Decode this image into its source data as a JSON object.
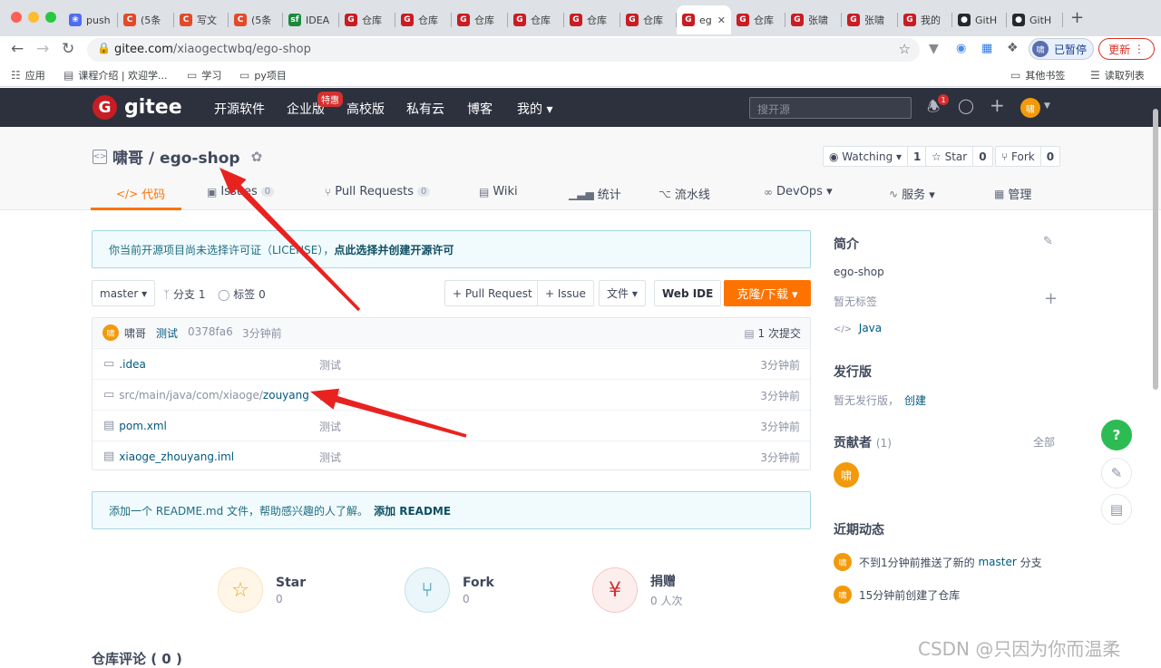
{
  "browser": {
    "tabs": [
      {
        "label": "push",
        "fav_color": "#4e6ef2",
        "fav_glyph": "❀"
      },
      {
        "label": "(5条",
        "fav_color": "#e24a2a",
        "fav_glyph": "C"
      },
      {
        "label": "写文",
        "fav_color": "#e24a2a",
        "fav_glyph": "C"
      },
      {
        "label": "(5条",
        "fav_color": "#e24a2a",
        "fav_glyph": "C"
      },
      {
        "label": "IDEA",
        "fav_color": "#1a8a3d",
        "fav_glyph": "sf"
      },
      {
        "label": "仓库",
        "fav_color": "#c71d23",
        "fav_glyph": "G"
      },
      {
        "label": "仓库",
        "fav_color": "#c71d23",
        "fav_glyph": "G"
      },
      {
        "label": "仓库",
        "fav_color": "#c71d23",
        "fav_glyph": "G"
      },
      {
        "label": "仓库",
        "fav_color": "#c71d23",
        "fav_glyph": "G"
      },
      {
        "label": "仓库",
        "fav_color": "#c71d23",
        "fav_glyph": "G"
      },
      {
        "label": "仓库",
        "fav_color": "#c71d23",
        "fav_glyph": "G"
      },
      {
        "label": "eg",
        "fav_color": "#c71d23",
        "fav_glyph": "G",
        "active": true
      },
      {
        "label": "仓库",
        "fav_color": "#c71d23",
        "fav_glyph": "G"
      },
      {
        "label": "张啸",
        "fav_color": "#c71d23",
        "fav_glyph": "G"
      },
      {
        "label": "张啸",
        "fav_color": "#c71d23",
        "fav_glyph": "G"
      },
      {
        "label": "我的",
        "fav_color": "#c71d23",
        "fav_glyph": "G"
      },
      {
        "label": "GitH",
        "fav_color": "#24292e",
        "fav_glyph": "●"
      },
      {
        "label": "GitH",
        "fav_color": "#24292e",
        "fav_glyph": "●"
      }
    ],
    "url_host": "gitee.com",
    "url_path": "/xiaogectwbq/ego-shop",
    "paused_label": "已暂停",
    "paused_avatar": "啸",
    "update_label": "更新",
    "bookmarks": [
      {
        "label": "应用",
        "icon": "apps-grid-icon",
        "glyph": "☷"
      },
      {
        "label": "课程介绍 | 欢迎学...",
        "icon": "book-icon",
        "glyph": "▤"
      },
      {
        "label": "学习",
        "icon": "folder-icon",
        "glyph": "▭"
      },
      {
        "label": "py项目",
        "icon": "folder-icon",
        "glyph": "▭"
      }
    ],
    "bookmarks_right": [
      {
        "label": "其他书签",
        "icon": "folder-icon",
        "glyph": "▭"
      },
      {
        "label": "读取列表",
        "icon": "reading-list-icon",
        "glyph": "☰"
      }
    ]
  },
  "gitee": {
    "logo_text": "gitee",
    "logo_glyph": "G",
    "nav": [
      "开源软件",
      "企业版",
      "高校版",
      "私有云",
      "博客",
      "我的 ▾"
    ],
    "nav_badge": "特惠",
    "search_placeholder": "搜开源",
    "notif_count": "1",
    "user_avatar": "啸"
  },
  "repo": {
    "title": "啸哥 / ego-shop",
    "title_icon": "<>",
    "watch": {
      "label": "◉ Watching ▾",
      "count": "1"
    },
    "star": {
      "label": "☆ Star",
      "count": "0"
    },
    "fork": {
      "label": "⑂ Fork",
      "count": "0"
    },
    "tabs": [
      {
        "label": "代码",
        "icon": "</>"
      },
      {
        "label": "Issues",
        "icon": "▣",
        "count": "0"
      },
      {
        "label": "Pull Requests",
        "icon": "⑂",
        "count": "0"
      },
      {
        "label": "Wiki",
        "icon": "▤"
      },
      {
        "label": "统计",
        "icon": "▁▃▅"
      },
      {
        "label": "流水线",
        "icon": "⌥"
      },
      {
        "label": "DevOps ▾",
        "icon": "∞"
      },
      {
        "label": "服务 ▾",
        "icon": "∿"
      },
      {
        "label": "管理",
        "icon": "▦"
      }
    ],
    "license_notice": "你当前开源项目尚未选择许可证（LICENSE），",
    "license_link": "点此选择并创建开源许可",
    "branch": "master ▾",
    "branches": "分支 1",
    "tags": "标签 0",
    "pull_request_btn": "+ Pull Request",
    "issue_btn": "+ Issue",
    "file_btn": "文件 ▾",
    "webide_btn": "Web IDE",
    "clone_btn": "克隆/下载 ▾",
    "last_commit": {
      "avatar": "啸",
      "author": "啸哥",
      "message": "测试",
      "hash": "0378fa6",
      "time": "3分钟前",
      "commits": "1 次提交"
    },
    "files": [
      {
        "icon": "folder-icon",
        "glyph": "▭",
        "prefix": "",
        "name": ".idea",
        "message": "测试",
        "time": "3分钟前"
      },
      {
        "icon": "folder-icon",
        "glyph": "▭",
        "prefix": "src/main/java/com/xiaoge/",
        "name": "zouyang",
        "message": "测试",
        "time": "3分钟前"
      },
      {
        "icon": "file-icon",
        "glyph": "▤",
        "prefix": "",
        "name": "pom.xml",
        "message": "测试",
        "time": "3分钟前"
      },
      {
        "icon": "file-icon",
        "glyph": "▤",
        "prefix": "",
        "name": "xiaoge_zhouyang.iml",
        "message": "测试",
        "time": "3分钟前"
      }
    ],
    "readme_notice": "添加一个 README.md 文件，帮助感兴趣的人了解。",
    "readme_link": "添加 README",
    "stats": [
      {
        "label": "Star",
        "value": "0",
        "glyph": "☆",
        "color": "#f0a020",
        "bg": "#fff6e8",
        "icon": "star-icon"
      },
      {
        "label": "Fork",
        "value": "0",
        "glyph": "⑂",
        "color": "#2a8fb0",
        "bg": "#eaf6fa",
        "icon": "fork-icon"
      },
      {
        "label": "捐赠",
        "value": "0 人次",
        "glyph": "¥",
        "color": "#d52f2f",
        "bg": "#fdeeee",
        "icon": "donate-icon"
      }
    ],
    "comments_heading": "仓库评论 ( 0 )"
  },
  "sidebar": {
    "intro_heading": "简介",
    "intro_text": "ego-shop",
    "no_tags": "暂无标签",
    "language": "Java",
    "releases_heading": "发行版",
    "no_releases": "暂无发行版，",
    "create_link": "创建",
    "contributors_heading": "贡献者",
    "contributors_count": "(1)",
    "all_link": "全部",
    "contributor_avatar": "啸",
    "activity_heading": "近期动态",
    "activities": [
      {
        "avatar": "啸",
        "text_before": "不到1分钟前推送了新的 ",
        "link": "master",
        "text_after": " 分支"
      },
      {
        "avatar": "啸",
        "text_before": "15分钟前创建了仓库",
        "link": "",
        "text_after": ""
      }
    ]
  },
  "annotations": {
    "arrow_color": "#e8231f"
  },
  "watermark": "CSDN @只因为你而温柔"
}
